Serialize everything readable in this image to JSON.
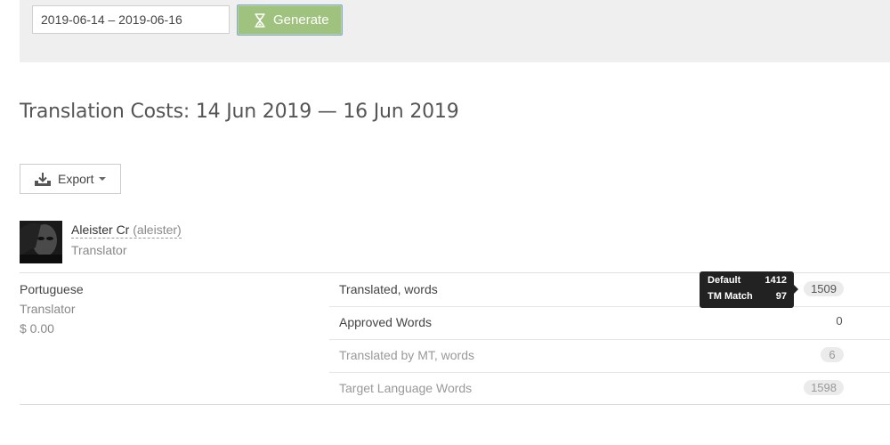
{
  "filter": {
    "date_range": "2019-06-14 – 2019-06-16",
    "generate_label": "Generate"
  },
  "page": {
    "title": "Translation Costs: 14 Jun 2019 — 16 Jun 2019"
  },
  "toolbar": {
    "export_label": "Export"
  },
  "user": {
    "name": "Aleister Cr",
    "handle": "(aleister)",
    "role": "Translator"
  },
  "language": {
    "name": "Portuguese",
    "role": "Translator",
    "cost": "$ 0.00"
  },
  "metrics": [
    {
      "label": "Translated, words",
      "value": "1509"
    },
    {
      "label": "Approved Words",
      "value": "0"
    },
    {
      "label": "Translated by MT, words",
      "value": "6"
    },
    {
      "label": "Target Language Words",
      "value": "1598"
    }
  ],
  "tooltip": {
    "rows": [
      {
        "label": "Default",
        "value": "1412"
      },
      {
        "label": "TM Match",
        "value": "97"
      }
    ]
  },
  "colors": {
    "generate_button": "#9fc27e",
    "topbar_bg": "#efefef",
    "tooltip_bg": "#222222"
  },
  "icons": {
    "generate": "hourglass-icon",
    "export": "download-tray-icon",
    "caret": "caret-down-icon"
  }
}
